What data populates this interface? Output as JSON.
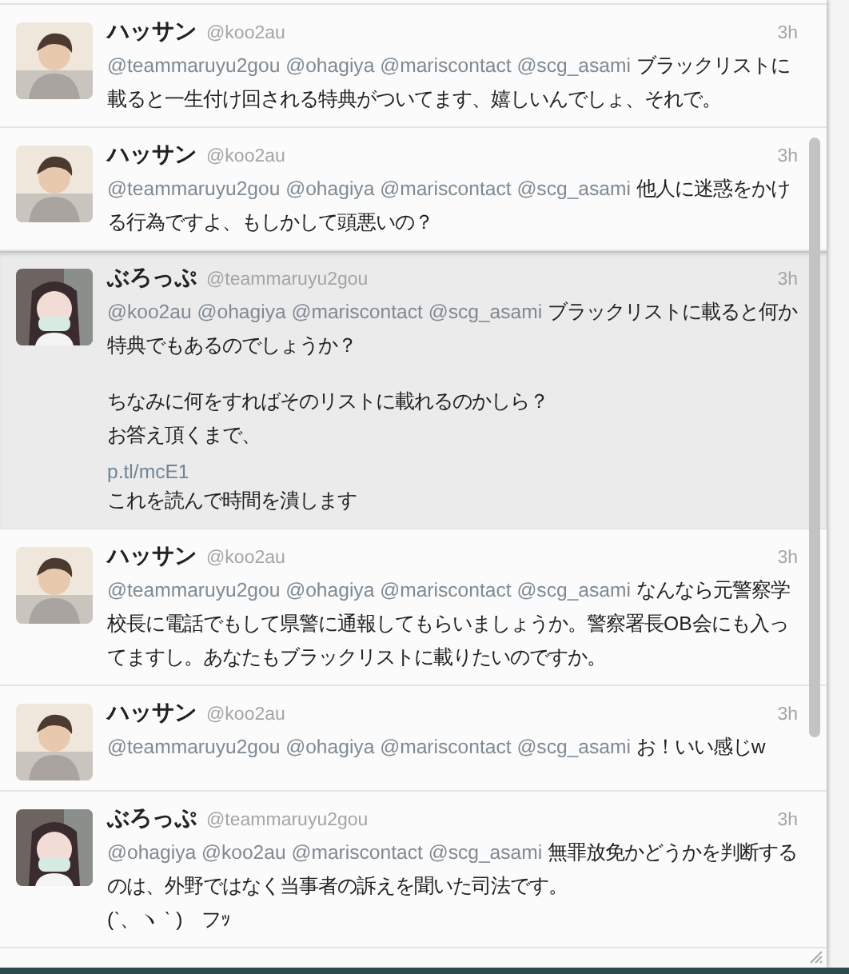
{
  "tweets": [
    {
      "name": "ハッサン",
      "handle": "@koo2au",
      "time": "3h",
      "selected": false,
      "mentions": [
        "@teammaruyu2gou",
        "@ohagiya",
        "@mariscontact",
        "@scg_asami"
      ],
      "text": "ブラックリストに載ると一生付け回される特典がついてます、嬉しいんでしょ、それで。"
    },
    {
      "name": "ハッサン",
      "handle": "@koo2au",
      "time": "3h",
      "selected": false,
      "mentions": [
        "@teammaruyu2gou",
        "@ohagiya",
        "@mariscontact",
        "@scg_asami"
      ],
      "text": "他人に迷惑をかける行為ですよ、もしかして頭悪いの？"
    },
    {
      "name": "ぶろっぷ",
      "handle": "@teammaruyu2gou",
      "time": "3h",
      "selected": true,
      "mentions": [
        "@koo2au",
        "@ohagiya",
        "@mariscontact",
        "@scg_asami"
      ],
      "text": "ブラックリストに載ると何か特典でもあるのでしょうか？",
      "blocks": [
        {
          "kind": "paragraph",
          "text": "ちなみに何をすればそのリストに載れるのかしら？"
        },
        {
          "kind": "text",
          "text": "お答え頂くまで、"
        },
        {
          "kind": "link",
          "text": "p.tl/mcE1"
        },
        {
          "kind": "text",
          "text": "これを読んで時間を潰します"
        }
      ]
    },
    {
      "name": "ハッサン",
      "handle": "@koo2au",
      "time": "3h",
      "selected": false,
      "mentions": [
        "@teammaruyu2gou",
        "@ohagiya",
        "@mariscontact",
        "@scg_asami"
      ],
      "text": "なんなら元警察学校長に電話でもして県警に通報してもらいましょうか。警察署長OB会にも入ってますし。あなたもブラックリストに載りたいのですか。"
    },
    {
      "name": "ハッサン",
      "handle": "@koo2au",
      "time": "3h",
      "selected": false,
      "mentions": [
        "@teammaruyu2gou",
        "@ohagiya",
        "@mariscontact",
        "@scg_asami"
      ],
      "text": "お！いい感じw"
    },
    {
      "name": "ぶろっぷ",
      "handle": "@teammaruyu2gou",
      "time": "3h",
      "selected": false,
      "mentions": [
        "@ohagiya",
        "@koo2au",
        "@mariscontact",
        "@scg_asami"
      ],
      "text": "無罪放免かどうかを判断するのは、外野ではなく当事者の訴えを聞いた司法です。",
      "blocks": [
        {
          "kind": "text",
          "text": "(ˋ、ヽ ˋ )　フｯ"
        }
      ]
    }
  ]
}
